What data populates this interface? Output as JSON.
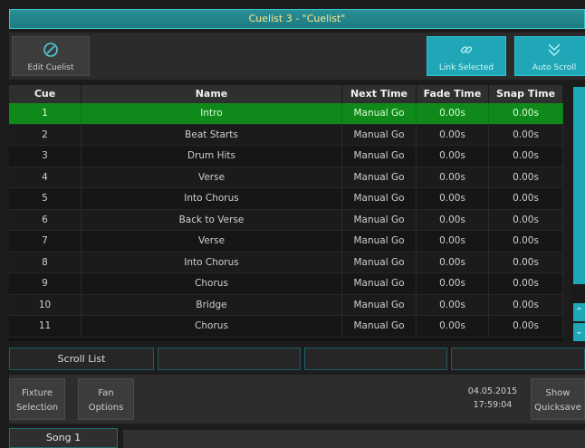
{
  "window": {
    "title": "Cuelist 3 - \"Cuelist\""
  },
  "toolbar": {
    "edit_cuelist": "Edit Cuelist",
    "link_selected": "Link Selected",
    "auto_scroll": "Auto Scroll"
  },
  "table": {
    "headers": [
      "Cue",
      "Name",
      "Next Time",
      "Fade Time",
      "Snap Time"
    ],
    "rows": [
      [
        "1",
        "Intro",
        "Manual Go",
        "0.00s",
        "0.00s"
      ],
      [
        "2",
        "Beat Starts",
        "Manual Go",
        "0.00s",
        "0.00s"
      ],
      [
        "3",
        "Drum Hits",
        "Manual Go",
        "0.00s",
        "0.00s"
      ],
      [
        "4",
        "Verse",
        "Manual Go",
        "0.00s",
        "0.00s"
      ],
      [
        "5",
        "Into Chorus",
        "Manual Go",
        "0.00s",
        "0.00s"
      ],
      [
        "6",
        "Back to Verse",
        "Manual Go",
        "0.00s",
        "0.00s"
      ],
      [
        "7",
        "Verse",
        "Manual Go",
        "0.00s",
        "0.00s"
      ],
      [
        "8",
        "Into Chorus",
        "Manual Go",
        "0.00s",
        "0.00s"
      ],
      [
        "9",
        "Chorus",
        "Manual Go",
        "0.00s",
        "0.00s"
      ],
      [
        "10",
        "Bridge",
        "Manual Go",
        "0.00s",
        "0.00s"
      ],
      [
        "11",
        "Chorus",
        "Manual Go",
        "0.00s",
        "0.00s"
      ]
    ],
    "active_row": 0
  },
  "scroll_list": {
    "label": "Scroll List"
  },
  "bottom": {
    "fixture_selection_1": "Fixture",
    "fixture_selection_2": "Selection",
    "fan_options_1": "Fan",
    "fan_options_2": "Options",
    "date": "04.05.2015",
    "time": "17:59:04",
    "show_quicksave_1": "Show",
    "show_quicksave_2": "Quicksave"
  },
  "tabs": {
    "song": "Song 1"
  },
  "colors": {
    "accent": "#1fa7b7",
    "active_row": "#0f8a1a",
    "title_text": "#ffe88a"
  },
  "icons": [
    "edit-cuelist-icon",
    "link-icon",
    "auto-scroll-icon",
    "chevron-up-icon",
    "chevron-down-icon"
  ]
}
